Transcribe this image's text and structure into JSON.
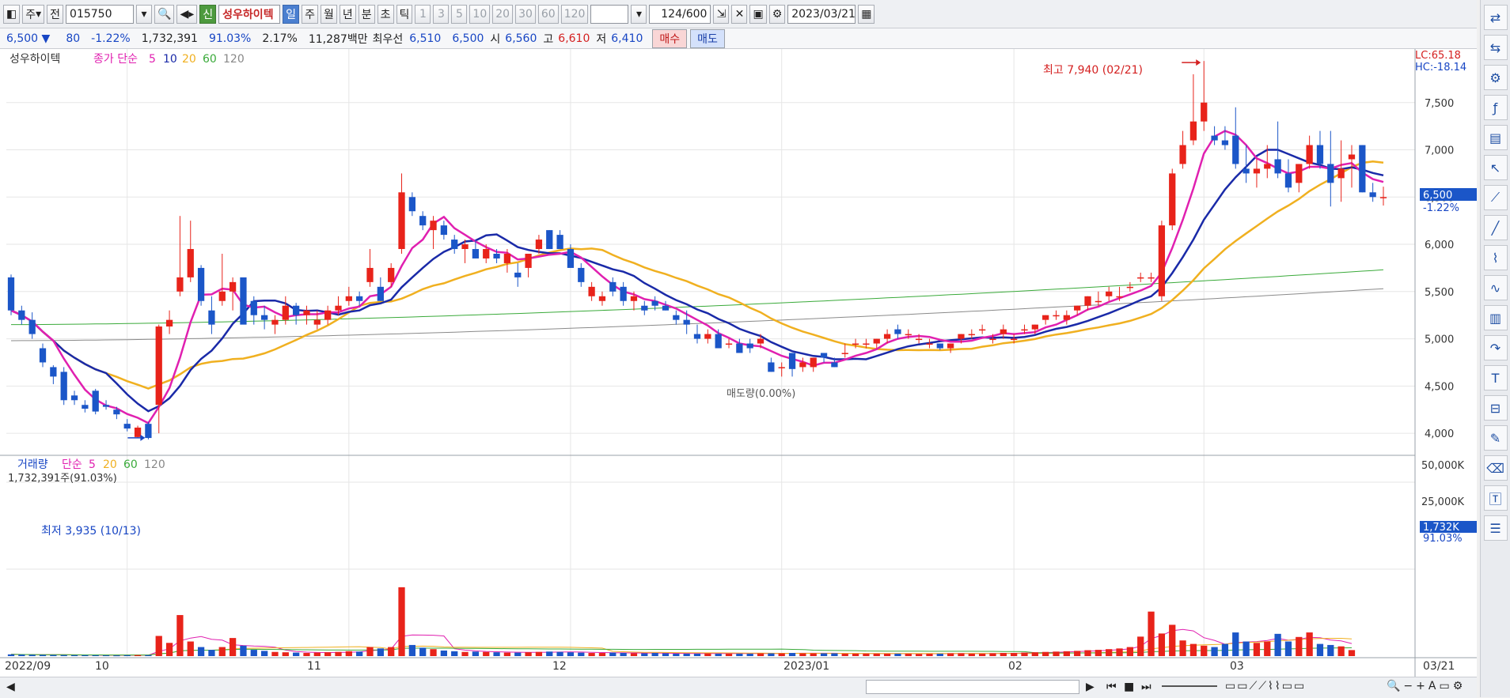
{
  "toolbar": {
    "mode": "주",
    "prev_label": "전",
    "code": "015750",
    "new_badge": "신",
    "stock_name": "성우하이텍",
    "periods": [
      "일",
      "주",
      "월",
      "년",
      "분",
      "초",
      "틱"
    ],
    "active_period": "일",
    "ticks": [
      "1",
      "3",
      "5",
      "10",
      "20",
      "30",
      "60",
      "120"
    ],
    "count": "124",
    "count_total": "/600",
    "date": "2023/03/21"
  },
  "quote": {
    "price": "6,500",
    "arrow": "▼",
    "change": "80",
    "rate": "-1.22%",
    "volume": "1,732,391",
    "vol_ratio": "91.03%",
    "turnover": "2.17%",
    "amount": "11,287백만",
    "bid_label": "최우선",
    "bid1": "6,510",
    "bid2": "6,500",
    "open_label": "시",
    "open": "6,560",
    "high_label": "고",
    "high": "6,610",
    "low_label": "저",
    "low": "6,410",
    "buy": "매수",
    "sell": "매도"
  },
  "price_panel": {
    "stock_name": "성우하이텍",
    "ma_label": "종가 단순",
    "ma_periods": [
      "5",
      "10",
      "20",
      "60",
      "120"
    ],
    "lc": "LC:65.18",
    "hc": "HC:-18.14",
    "high_note": "최고 7,940 (02/21)",
    "low_note": "최저 3,935 (10/13)",
    "sell_rate_note": "매도량(0.00%)",
    "last_price": "6,500",
    "last_rate": "-1.22%"
  },
  "volume_panel": {
    "label": "거래량",
    "ma_label": "단순",
    "ma_periods": [
      "5",
      "20",
      "60",
      "120"
    ],
    "current": "1,732,391주(91.03%)",
    "axis": [
      "50,000K",
      "25,000K"
    ],
    "last_value": "1,732K",
    "last_rate": "91.03%"
  },
  "colors": {
    "up": "#e8231a",
    "down": "#1b56c8",
    "ma5": "#e020b0",
    "ma10": "#1a2aa8",
    "ma20": "#f0b020",
    "ma60": "#3aaa3a",
    "ma120": "#8a8a8a"
  },
  "chart_data": {
    "type": "candlestick",
    "x_axis_labels": [
      "2022/09",
      "10",
      "11",
      "12",
      "2023/01",
      "02",
      "03",
      "03/21"
    ],
    "ylim": [
      3800,
      8000
    ],
    "y_ticks": [
      4000,
      4500,
      5000,
      5500,
      6000,
      6500,
      7000,
      7500
    ],
    "volume_ylim_k": [
      0,
      50000
    ],
    "volume_ticks_k": [
      25000,
      50000
    ],
    "candles": [
      [
        5650,
        5680,
        5250,
        5300
      ],
      [
        5300,
        5350,
        5150,
        5200
      ],
      [
        5200,
        5280,
        5000,
        5050
      ],
      [
        4900,
        4950,
        4700,
        4750
      ],
      [
        4700,
        4720,
        4520,
        4600
      ],
      [
        4650,
        4700,
        4300,
        4350
      ],
      [
        4400,
        4450,
        4300,
        4350
      ],
      [
        4300,
        4350,
        4220,
        4260
      ],
      [
        4450,
        4470,
        4200,
        4230
      ],
      [
        4300,
        4350,
        4250,
        4280
      ],
      [
        4250,
        4280,
        4150,
        4200
      ],
      [
        4100,
        4150,
        4020,
        4050
      ],
      [
        3960,
        4080,
        3950,
        4060
      ],
      [
        4100,
        4120,
        3935,
        3950
      ],
      [
        4300,
        5150,
        4000,
        5130
      ],
      [
        5130,
        5300,
        5050,
        5200
      ],
      [
        5500,
        6300,
        5450,
        5650
      ],
      [
        5650,
        6250,
        5600,
        5950
      ],
      [
        5750,
        5780,
        5350,
        5400
      ],
      [
        5300,
        5450,
        5050,
        5150
      ],
      [
        5400,
        5900,
        5350,
        5500
      ],
      [
        5500,
        5650,
        5300,
        5600
      ],
      [
        5650,
        5550,
        5200,
        5150
      ],
      [
        5400,
        5450,
        5150,
        5250
      ],
      [
        5250,
        5350,
        5100,
        5200
      ],
      [
        5150,
        5250,
        5050,
        5200
      ],
      [
        5200,
        5450,
        5150,
        5350
      ],
      [
        5350,
        5380,
        5150,
        5250
      ],
      [
        5250,
        5350,
        5150,
        5300
      ],
      [
        5150,
        5300,
        5100,
        5200
      ],
      [
        5200,
        5350,
        5150,
        5300
      ],
      [
        5300,
        5450,
        5250,
        5350
      ],
      [
        5400,
        5550,
        5350,
        5450
      ],
      [
        5450,
        5500,
        5350,
        5400
      ],
      [
        5600,
        5950,
        5550,
        5750
      ],
      [
        5550,
        5650,
        5400,
        5400
      ],
      [
        5600,
        5800,
        5550,
        5750
      ],
      [
        5950,
        6750,
        5900,
        6550
      ],
      [
        6500,
        6550,
        6300,
        6350
      ],
      [
        6300,
        6350,
        6150,
        6200
      ],
      [
        6150,
        6300,
        5950,
        6250
      ],
      [
        6200,
        6250,
        6050,
        6100
      ],
      [
        6050,
        6100,
        5900,
        5950
      ],
      [
        5950,
        6050,
        5800,
        6000
      ],
      [
        5950,
        6050,
        5850,
        5850
      ],
      [
        5850,
        6000,
        5800,
        5950
      ],
      [
        5900,
        5950,
        5800,
        5850
      ],
      [
        5800,
        5950,
        5700,
        5900
      ],
      [
        5700,
        5800,
        5550,
        5650
      ],
      [
        5750,
        5900,
        5650,
        5900
      ],
      [
        5950,
        6100,
        5900,
        6050
      ],
      [
        6150,
        6150,
        5950,
        5950
      ],
      [
        6100,
        6150,
        5950,
        5950
      ],
      [
        5950,
        6000,
        5750,
        5750
      ],
      [
        5750,
        5800,
        5550,
        5600
      ],
      [
        5450,
        5600,
        5400,
        5550
      ],
      [
        5400,
        5500,
        5350,
        5450
      ],
      [
        5600,
        5650,
        5450,
        5500
      ],
      [
        5550,
        5600,
        5350,
        5400
      ],
      [
        5400,
        5500,
        5300,
        5450
      ],
      [
        5350,
        5400,
        5250,
        5300
      ],
      [
        5400,
        5450,
        5300,
        5350
      ],
      [
        5350,
        5400,
        5300,
        5300
      ],
      [
        5250,
        5300,
        5150,
        5200
      ],
      [
        5200,
        5300,
        5050,
        5150
      ],
      [
        5050,
        5150,
        4950,
        5000
      ],
      [
        5000,
        5100,
        4950,
        5050
      ],
      [
        5050,
        5100,
        4900,
        4900
      ],
      [
        4950,
        5000,
        4900,
        4950
      ],
      [
        4950,
        5000,
        4850,
        4850
      ],
      [
        4950,
        5000,
        4850,
        4900
      ],
      [
        4950,
        5050,
        4900,
        5000
      ],
      [
        4750,
        4800,
        4650,
        4650
      ],
      [
        4700,
        4750,
        4600,
        4700
      ],
      [
        4850,
        4850,
        4600,
        4680
      ],
      [
        4700,
        4800,
        4650,
        4750
      ],
      [
        4700,
        4800,
        4650,
        4800
      ],
      [
        4850,
        4850,
        4750,
        4800
      ],
      [
        4750,
        4800,
        4700,
        4700
      ],
      [
        4850,
        4950,
        4800,
        4850
      ],
      [
        4950,
        5000,
        4900,
        4950
      ],
      [
        4950,
        5000,
        4900,
        4950
      ],
      [
        4950,
        5000,
        4900,
        5000
      ],
      [
        5000,
        5100,
        4950,
        5050
      ],
      [
        5100,
        5150,
        5000,
        5050
      ],
      [
        5050,
        5100,
        5000,
        5050
      ],
      [
        5000,
        5050,
        4950,
        5000
      ],
      [
        4950,
        5000,
        4900,
        4950
      ],
      [
        4950,
        4950,
        4880,
        4900
      ],
      [
        4900,
        4950,
        4850,
        4950
      ],
      [
        5000,
        5050,
        4950,
        5050
      ],
      [
        5050,
        5100,
        5000,
        5050
      ],
      [
        5100,
        5150,
        5050,
        5100
      ],
      [
        5000,
        5050,
        4950,
        5000
      ],
      [
        5050,
        5150,
        5000,
        5100
      ],
      [
        5000,
        5050,
        4950,
        5000
      ],
      [
        5100,
        5150,
        5050,
        5100
      ],
      [
        5100,
        5150,
        5050,
        5150
      ],
      [
        5200,
        5250,
        5150,
        5250
      ],
      [
        5250,
        5300,
        5200,
        5250
      ],
      [
        5200,
        5300,
        5150,
        5250
      ],
      [
        5300,
        5350,
        5250,
        5350
      ],
      [
        5350,
        5450,
        5300,
        5450
      ],
      [
        5400,
        5500,
        5350,
        5400
      ],
      [
        5450,
        5550,
        5400,
        5500
      ],
      [
        5450,
        5550,
        5400,
        5450
      ],
      [
        5550,
        5600,
        5500,
        5550
      ],
      [
        5650,
        5700,
        5600,
        5650
      ],
      [
        5650,
        5700,
        5600,
        5650
      ],
      [
        5450,
        6250,
        5400,
        6200
      ],
      [
        6200,
        6800,
        6150,
        6750
      ],
      [
        6850,
        7200,
        6800,
        7050
      ],
      [
        7100,
        7800,
        7050,
        7300
      ],
      [
        7300,
        7940,
        7200,
        7500
      ],
      [
        7150,
        7250,
        7050,
        7100
      ],
      [
        7100,
        7250,
        7000,
        7050
      ],
      [
        7150,
        7450,
        6800,
        6850
      ],
      [
        6800,
        7050,
        6650,
        6750
      ],
      [
        6750,
        6900,
        6600,
        6800
      ],
      [
        6800,
        7050,
        6700,
        6850
      ],
      [
        6900,
        7300,
        6700,
        6750
      ],
      [
        6750,
        6900,
        6550,
        6600
      ],
      [
        6650,
        6850,
        6550,
        6850
      ],
      [
        6850,
        7150,
        6800,
        7050
      ],
      [
        7050,
        7200,
        6800,
        6850
      ],
      [
        6850,
        7200,
        6400,
        6650
      ],
      [
        6700,
        7100,
        6450,
        6800
      ],
      [
        6900,
        7050,
        6600,
        6950
      ],
      [
        7050,
        7050,
        6550,
        6550
      ],
      [
        6550,
        6650,
        6450,
        6500
      ],
      [
        6500,
        6610,
        6410,
        6500
      ]
    ],
    "volume_k": [
      500,
      420,
      380,
      350,
      320,
      300,
      280,
      260,
      240,
      220,
      200,
      260,
      300,
      280,
      5800,
      3800,
      11800,
      4200,
      2600,
      1800,
      2600,
      5200,
      3000,
      1800,
      1500,
      1200,
      1100,
      1000,
      900,
      1000,
      1100,
      1200,
      1400,
      1300,
      2600,
      2200,
      2600,
      19800,
      3200,
      2400,
      2000,
      1600,
      1400,
      1200,
      1300,
      1200,
      1100,
      1000,
      1000,
      1100,
      1200,
      1300,
      1200,
      1100,
      1000,
      900,
      900,
      1000,
      900,
      800,
      800,
      900,
      800,
      700,
      700,
      700,
      800,
      700,
      700,
      700,
      700,
      800,
      800,
      800,
      900,
      800,
      800,
      800,
      800,
      700,
      700,
      700,
      700,
      700,
      700,
      700,
      600,
      700,
      700,
      800,
      800,
      700,
      700,
      800,
      900,
      900,
      1000,
      1100,
      1200,
      1300,
      1400,
      1500,
      1700,
      1800,
      2000,
      2200,
      2600,
      5600,
      12800,
      6500,
      9000,
      4500,
      3500,
      3000,
      2600,
      3500,
      6800,
      4200,
      3800,
      4200,
      6400,
      4200,
      5500,
      6800,
      3500,
      3200,
      2800,
      1732
    ],
    "ma20_end": 6900,
    "ma60_end": 5730,
    "ma120_end": 5530
  }
}
